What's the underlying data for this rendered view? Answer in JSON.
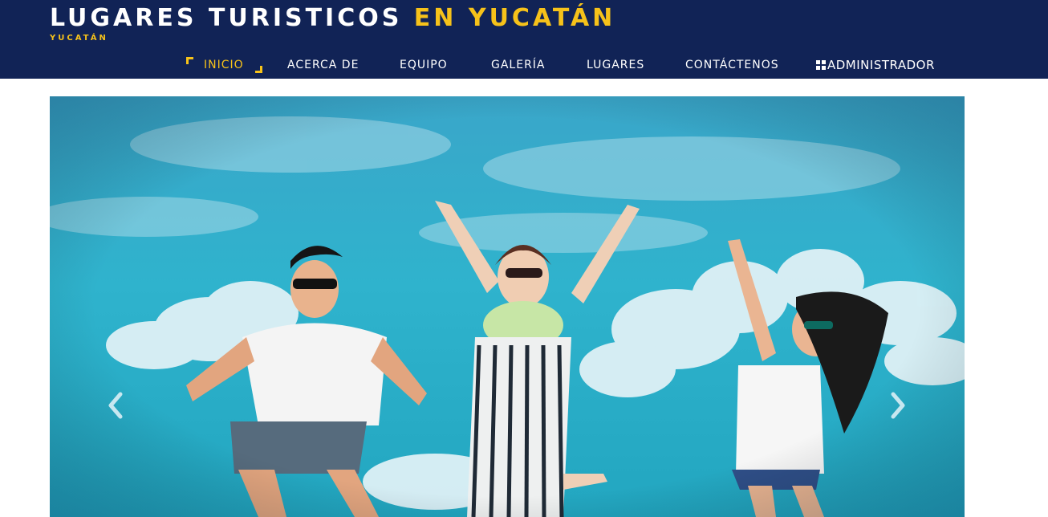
{
  "header": {
    "title_main": "LUGARES TURISTICOS ",
    "title_accent": "EN YUCATÁN",
    "subtitle": "YUCATÁN",
    "colors": {
      "background": "#112356",
      "accent": "#f6c21a",
      "text": "#ffffff"
    }
  },
  "nav": {
    "items": [
      {
        "label": "INICIO",
        "active": true
      },
      {
        "label": "ACERCA DE"
      },
      {
        "label": "EQUIPO"
      },
      {
        "label": "GALERÍA"
      },
      {
        "label": "LUGARES"
      },
      {
        "label": "CONTÁCTENOS"
      },
      {
        "label": "ADMINISTRADOR",
        "icon": "grid-icon"
      }
    ]
  },
  "carousel": {
    "image_alt": "",
    "prev_icon": "chevron-left-icon",
    "next_icon": "chevron-right-icon"
  }
}
